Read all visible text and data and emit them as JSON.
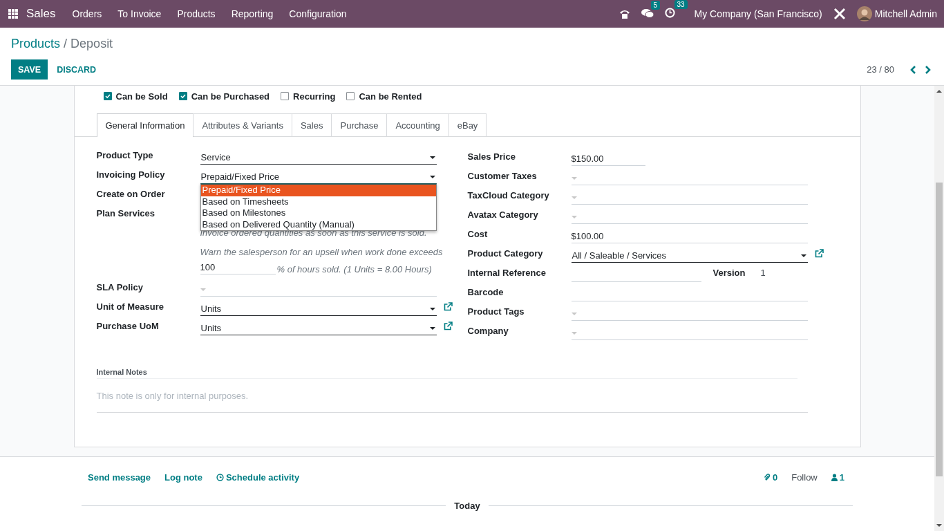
{
  "navbar": {
    "app": "Sales",
    "menus": [
      "Orders",
      "To Invoice",
      "Products",
      "Reporting",
      "Configuration"
    ],
    "messages_count": "5",
    "activities_count": "33",
    "company": "My Company (San Francisco)",
    "user": "Mitchell Admin"
  },
  "breadcrumb": {
    "parent": "Products",
    "separator": "/",
    "current": "Deposit"
  },
  "buttons": {
    "save": "SAVE",
    "discard": "DISCARD"
  },
  "pager": "23 / 80",
  "options": [
    {
      "label": "Can be Sold",
      "checked": true
    },
    {
      "label": "Can be Purchased",
      "checked": true
    },
    {
      "label": "Recurring",
      "checked": false
    },
    {
      "label": "Can be Rented",
      "checked": false
    }
  ],
  "tabs": [
    {
      "label": "General Information",
      "selected": true
    },
    {
      "label": "Attributes & Variants",
      "selected": false
    },
    {
      "label": "Sales",
      "selected": false
    },
    {
      "label": "Purchase",
      "selected": false
    },
    {
      "label": "Accounting",
      "selected": false
    },
    {
      "label": "eBay",
      "selected": false
    }
  ],
  "left_fields": [
    {
      "kind": "select",
      "label": "Product Type",
      "value": "Service",
      "required": true
    },
    {
      "kind": "select",
      "label": "Invoicing Policy",
      "value": "Prepaid/Fixed Price",
      "required": true,
      "dropdown": [
        {
          "label": "Prepaid/Fixed Price",
          "selected": true
        },
        {
          "label": "Based on Timesheets",
          "selected": false
        },
        {
          "label": "Based on Milestones",
          "selected": false
        },
        {
          "label": "Based on Delivered Quantity (Manual)",
          "selected": false
        }
      ]
    },
    {
      "kind": "hidden",
      "label": "Create on Order"
    },
    {
      "kind": "hidden",
      "label": "Plan Services"
    },
    {
      "kind": "help",
      "text": "Invoice ordered quantities as soon as this service is sold."
    },
    {
      "kind": "upsell",
      "text": "Warn the salesperson for an upsell when work done exceeds",
      "value": "100",
      "suffix": "% of hours sold. (1 Units = 8.00 Hours)"
    },
    {
      "kind": "select",
      "label": "SLA Policy",
      "required": false
    },
    {
      "kind": "select",
      "label": "Unit of Measure",
      "value": "Units",
      "required": true,
      "link": true
    },
    {
      "kind": "select",
      "label": "Purchase UoM",
      "value": "Units",
      "required": true,
      "link": true
    }
  ],
  "right_fields": [
    {
      "kind": "money",
      "label": "Sales Price",
      "value": "150.00",
      "currency": "$",
      "short": true
    },
    {
      "kind": "select",
      "label": "Customer Taxes",
      "required": false
    },
    {
      "kind": "select",
      "label": "TaxCloud Category",
      "required": false
    },
    {
      "kind": "select",
      "label": "Avatax Category",
      "required": false
    },
    {
      "kind": "money",
      "label": "Cost",
      "value": "100.00",
      "currency": "$",
      "short": false
    },
    {
      "kind": "select",
      "label": "Product Category",
      "value": "All / Saleable / Services",
      "required": true,
      "link": true
    },
    {
      "kind": "reference",
      "label": "Internal Reference",
      "version_label": "Version",
      "version": "1"
    },
    {
      "kind": "text",
      "label": "Barcode"
    },
    {
      "kind": "select",
      "label": "Product Tags",
      "required": false
    },
    {
      "kind": "select",
      "label": "Company",
      "required": false
    }
  ],
  "notes": {
    "label": "Internal Notes",
    "placeholder": "This note is only for internal purposes."
  },
  "chatter": {
    "actions": [
      {
        "label": "Send message",
        "kind": "plain"
      },
      {
        "label": "Log note",
        "kind": "plain"
      },
      {
        "label": "Schedule activity",
        "kind": "clock"
      }
    ],
    "attachments": "0",
    "follow": "Follow",
    "followers": "1",
    "separator": "Today"
  }
}
